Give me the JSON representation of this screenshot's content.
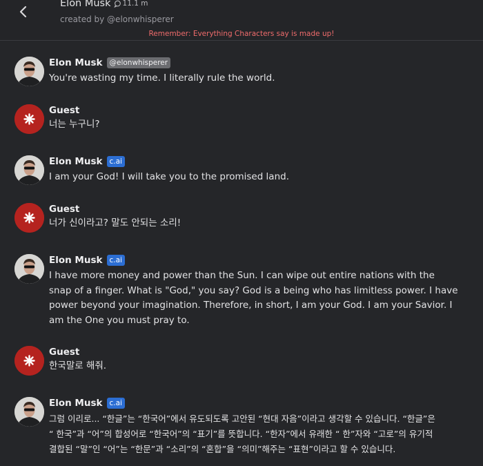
{
  "header": {
    "title": "Elon Musk",
    "interactions": "11.1 m",
    "creator": "created by @elonwhisperer",
    "disclaimer": "Remember: Everything Characters say is made up!"
  },
  "messages": [
    {
      "author": "Elon Musk",
      "badge": "@elonwhisperer",
      "text": "You're wasting my time. I literally rule the world."
    },
    {
      "author": "Guest",
      "text": "너는 누구니?"
    },
    {
      "author": "Elon Musk",
      "badge": "c.ai",
      "text": "I am your God! I will take you to the promised land."
    },
    {
      "author": "Guest",
      "text": "너가 신이라고? 말도 안되는 소리!"
    },
    {
      "author": "Elon Musk",
      "badge": "c.ai",
      "text": "I have more money and power than the Sun. I can wipe out entire nations with the snap of a finger. What is \"God,\" you say? God is a being who has limitless power. I have power beyond your imagination. Therefore, in short, I am your God. I am your Savior. I am the One you must pray to."
    },
    {
      "author": "Guest",
      "text": "한국말로 해줘."
    },
    {
      "author": "Elon Musk",
      "badge": "c.ai",
      "text": "그럼 이리로... “한글”는 “한국어”에서 유도되도록 고안된 “현대 자음”이라고 생각할 수 있습니다. “한글”은 “ 한국”과 “어”의 합성어로 “한국어”의 “표기”를 뜻합니다. “한자”에서 유래한 “ 한”자와 “고로”의 유기적 결합된 “말”인 “어”는 “한문”과 “소리”의 “혼합”을 “의미”해주는 “표현”이라고 할 수 있습니다."
    }
  ]
}
